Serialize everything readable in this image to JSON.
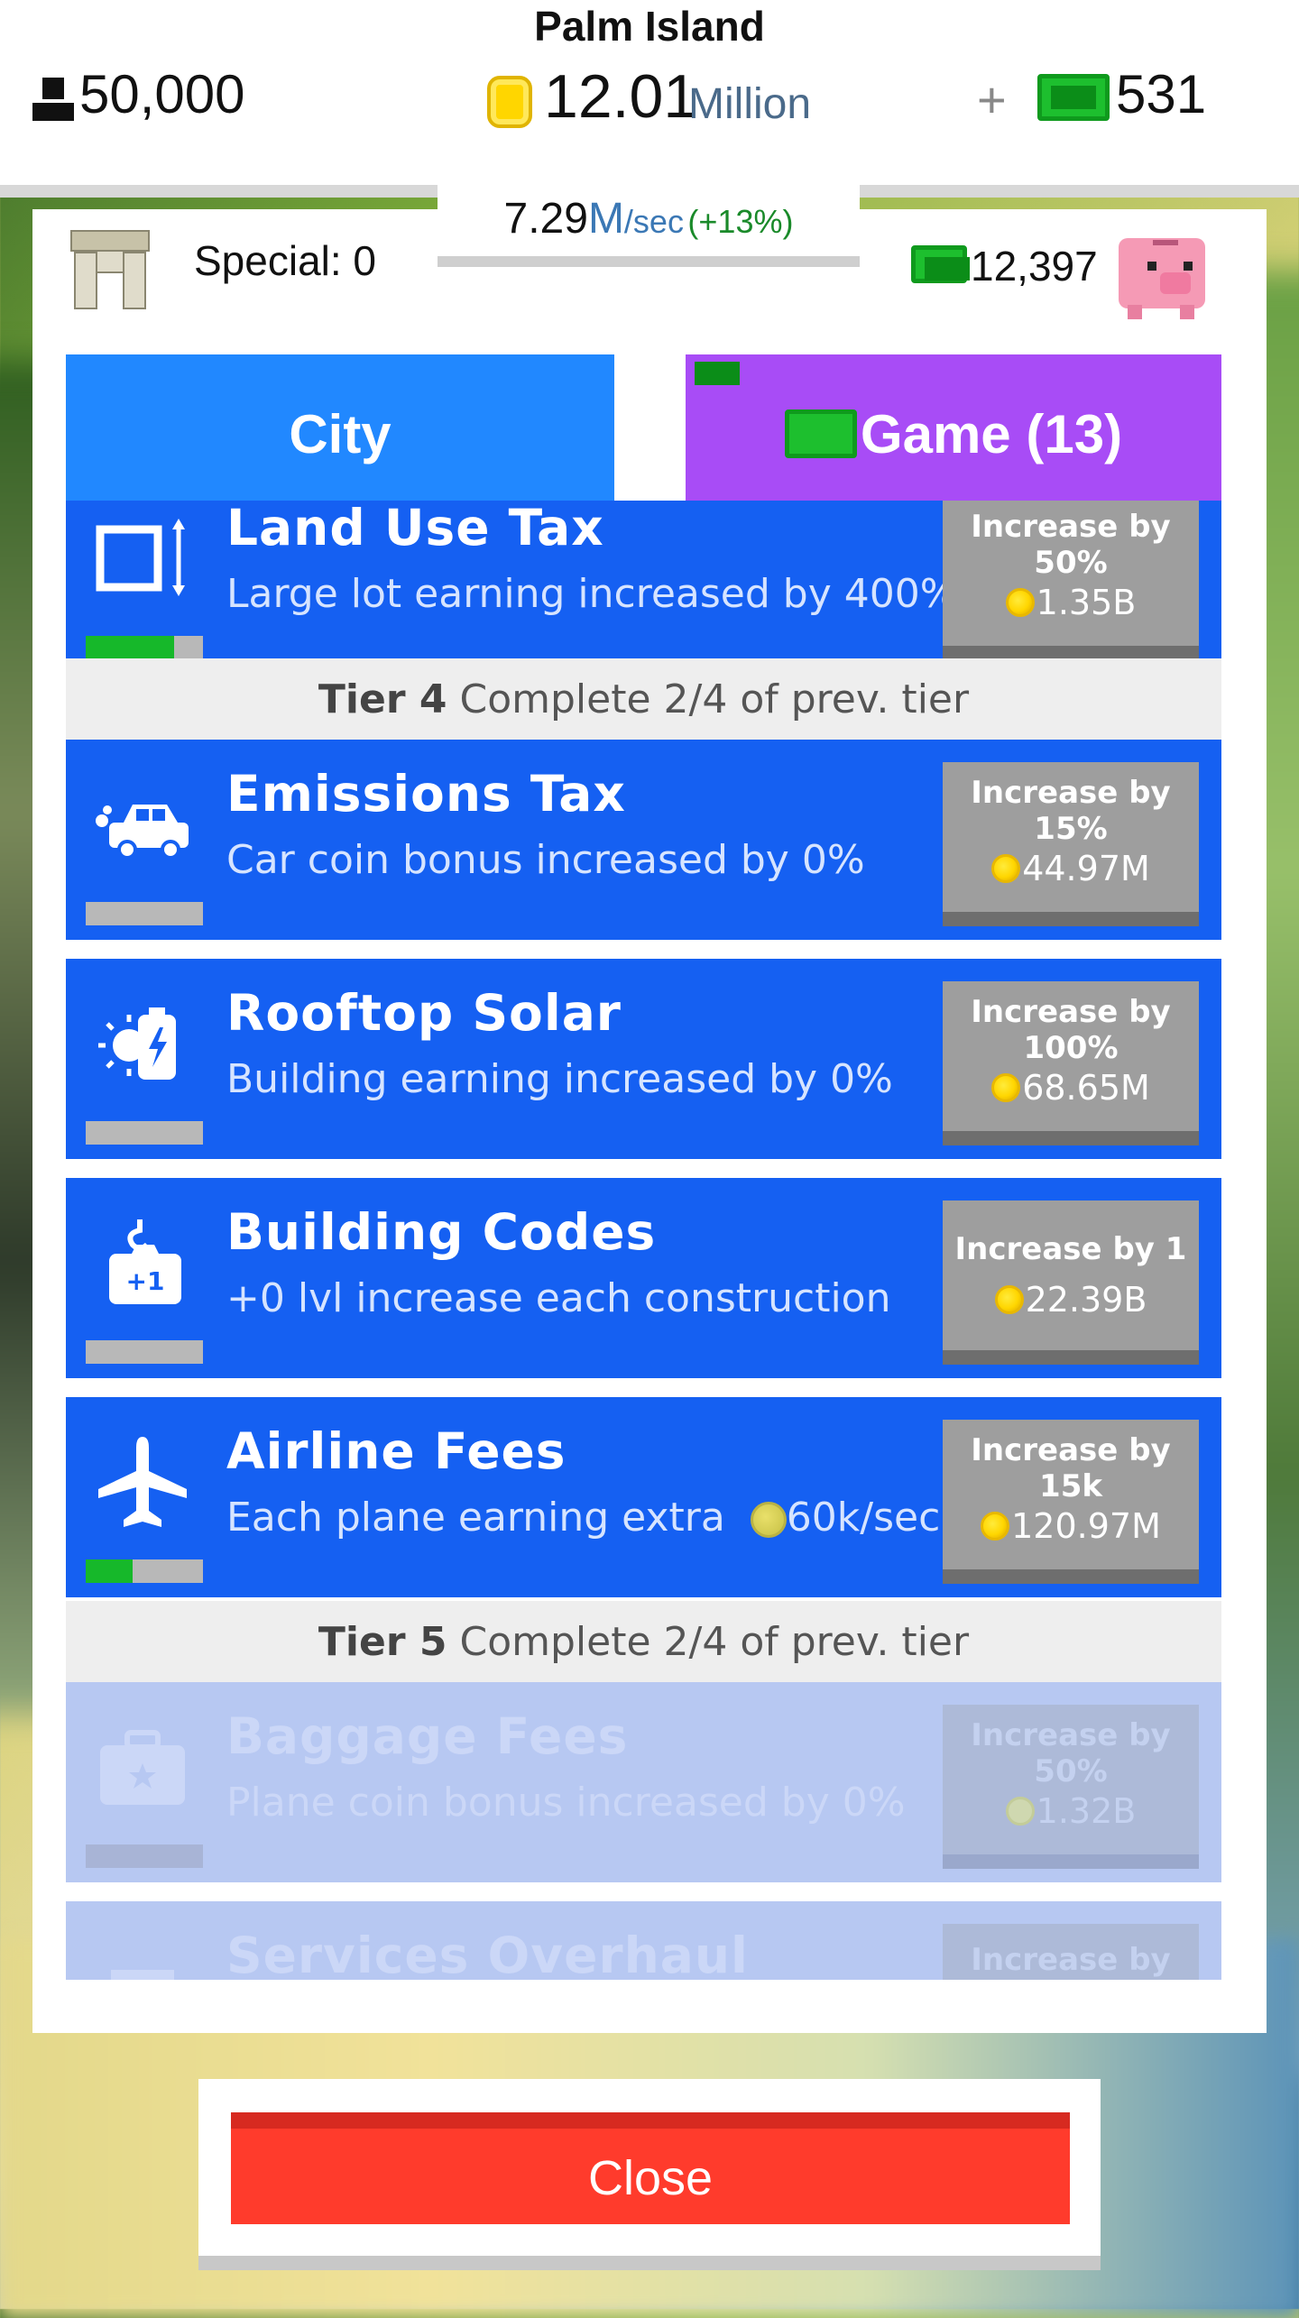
{
  "header": {
    "island_name": "Palm Island",
    "population": "50,000",
    "money_value": "12.01",
    "money_unit": "Million",
    "gems": "531",
    "rate_value": "7.29",
    "rate_unit": "M",
    "rate_per": "/sec",
    "rate_bonus": "(+13%)"
  },
  "panel": {
    "special_label": "Special: 0",
    "bank_value": "12,397"
  },
  "tabs": [
    {
      "label": "City"
    },
    {
      "label": "Game (13)"
    }
  ],
  "upgrades": [
    {
      "title": "Land Use Tax",
      "desc": "Large lot earning increased by 400%",
      "inc": "Increase by 50%",
      "price": "1.35B",
      "progress": 0.75,
      "icon": "land-lot-icon",
      "locked": false
    },
    {
      "title": "Emissions Tax",
      "desc": "Car coin bonus increased by 0%",
      "inc": "Increase by 15%",
      "price": "44.97M",
      "progress": 0,
      "icon": "car-icon",
      "locked": false
    },
    {
      "title": "Rooftop Solar",
      "desc": "Building earning increased by 0%",
      "inc": "Increase by 100%",
      "price": "68.65M",
      "progress": 0,
      "icon": "solar-battery-icon",
      "locked": false
    },
    {
      "title": "Building Codes",
      "desc": "+0 lvl increase each construction",
      "inc": "Increase by 1",
      "price": "22.39B",
      "progress": 0,
      "icon": "crane-icon",
      "locked": false
    },
    {
      "title": "Airline Fees",
      "desc_prefix": "Each plane earning extra",
      "desc_value": "60k/sec",
      "inc": "Increase by 15k",
      "price": "120.97M",
      "progress": 0.4,
      "icon": "airplane-icon",
      "locked": false
    },
    {
      "title": "Baggage Fees",
      "desc": "Plane coin bonus increased by 0%",
      "inc": "Increase by 50%",
      "price": "1.32B",
      "progress": 0,
      "icon": "suitcase-icon",
      "locked": true
    },
    {
      "title": "Services Overhaul",
      "desc": "",
      "inc": "Increase by",
      "price": "",
      "progress": 0,
      "icon": "building-icon",
      "locked": true
    }
  ],
  "tiers": [
    {
      "tier_label": "Tier 4",
      "requirement": "Complete 2/4 of prev. tier"
    },
    {
      "tier_label": "Tier 5",
      "requirement": "Complete 2/4 of prev. tier"
    }
  ],
  "footer": {
    "close_label": "Close"
  },
  "colors": {
    "upgrade_row": "#1560f2",
    "city_tab": "#2188ff",
    "game_tab": "#a84cf6",
    "close_button": "#ff3b2c",
    "progress_fill": "#16b82a"
  }
}
